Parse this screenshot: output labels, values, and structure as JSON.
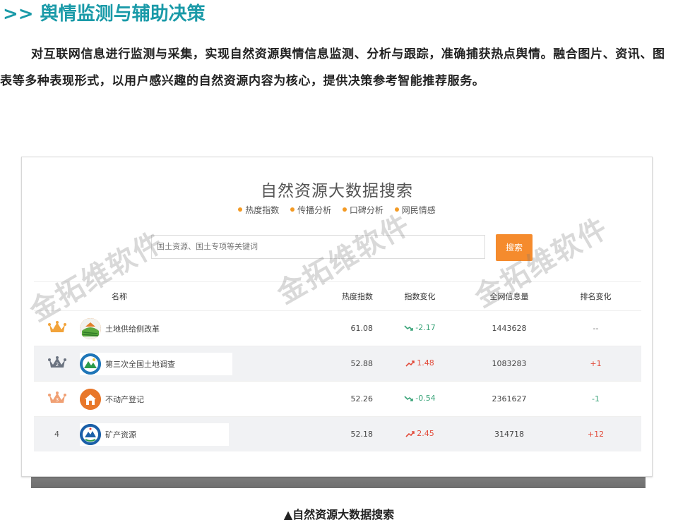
{
  "heading": ">> 舆情监测与辅助决策",
  "intro": "对互联网信息进行监测与采集，实现自然资源舆情信息监测、分析与跟踪，准确捕获热点舆情。融合图片、资讯、图表等多种表现形式，以用户感兴趣的自然资源内容为核心，提供决策参考智能推荐服务。",
  "panel": {
    "title": "自然资源大数据搜索",
    "tags": [
      "热度指数",
      "传播分析",
      "口碑分析",
      "网民情感"
    ],
    "search_placeholder": "国土资源、国土专项等关键词",
    "search_button": "搜索"
  },
  "table": {
    "headers": {
      "name": "名称",
      "heat": "热度指数",
      "index_change": "指数变化",
      "total": "全网信息量",
      "rank_change": "排名变化"
    },
    "rows": [
      {
        "rank": "1",
        "name": "土地供给侧改革",
        "heat": "61.08",
        "index_change": "-2.17",
        "direction": "down",
        "total": "1443628",
        "rank_change": "--",
        "rank_dir": "none",
        "icon": "farmland-icon",
        "icon_color": "#5aa83c"
      },
      {
        "rank": "2",
        "name": "第三次全国土地调查",
        "heat": "52.88",
        "index_change": "1.48",
        "direction": "up",
        "total": "1083283",
        "rank_change": "+1",
        "rank_dir": "up",
        "icon": "survey-globe-icon",
        "icon_color": "#1f76b8"
      },
      {
        "rank": "3",
        "name": "不动产登记",
        "heat": "52.26",
        "index_change": "-0.54",
        "direction": "down",
        "total": "2361627",
        "rank_change": "-1",
        "rank_dir": "down",
        "icon": "house-icon",
        "icon_color": "#e8772a"
      },
      {
        "rank": "4",
        "name": "矿产资源",
        "heat": "52.18",
        "index_change": "2.45",
        "direction": "up",
        "total": "314718",
        "rank_change": "+12",
        "rank_dir": "up",
        "icon": "mineral-emblem-icon",
        "icon_color": "#1a5fa8"
      }
    ]
  },
  "watermark": "金拓维软件",
  "caption": "▲自然资源大数据搜索",
  "colors": {
    "accent": "#1a9aa8",
    "button": "#f58b2d",
    "up": "#e24b3a",
    "down": "#39a378"
  }
}
